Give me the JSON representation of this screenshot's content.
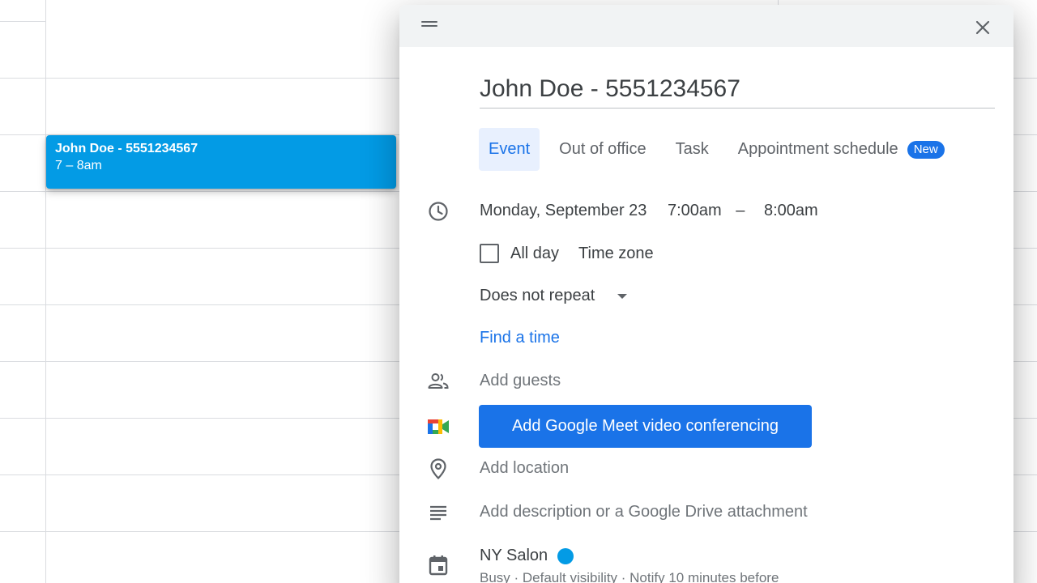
{
  "calendar": {
    "event_chip": {
      "title": "John Doe - 5551234567",
      "time": "7 – 8am"
    }
  },
  "dialog": {
    "title_value": "John Doe - 5551234567",
    "tabs": [
      {
        "label": "Event",
        "active": true
      },
      {
        "label": "Out of office",
        "active": false
      },
      {
        "label": "Task",
        "active": false
      },
      {
        "label": "Appointment schedule",
        "active": false,
        "badge": "New"
      }
    ],
    "date": "Monday, September 23",
    "start_time": "7:00am",
    "time_separator": "–",
    "end_time": "8:00am",
    "all_day_label": "All day",
    "time_zone_label": "Time zone",
    "repeat_label": "Does not repeat",
    "find_time_label": "Find a time",
    "add_guests_placeholder": "Add guests",
    "meet_button_label": "Add Google Meet video conferencing",
    "add_location_placeholder": "Add location",
    "add_description_placeholder": "Add description or a Google Drive attachment",
    "calendar_name": "NY Salon",
    "calendar_color": "#039be5",
    "calendar_details": "Busy · Default visibility · Notify 10 minutes before"
  },
  "icons": {
    "drag": "drag-handle-icon",
    "close": "close-icon",
    "clock": "clock-icon",
    "guests": "people-icon",
    "meet": "google-meet-icon",
    "location": "location-pin-icon",
    "description": "notes-icon",
    "calendar": "calendar-icon"
  },
  "colors": {
    "accent": "#1a73e8",
    "event": "#039be5",
    "active_tab_bg": "#e8f0fe"
  }
}
